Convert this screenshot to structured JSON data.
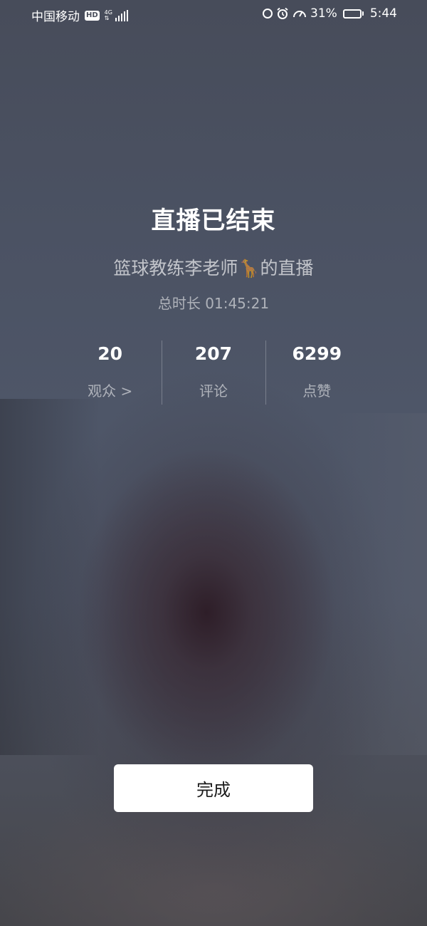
{
  "status_bar": {
    "carrier": "中国移动",
    "hd_badge": "HD",
    "network_type": "4G",
    "signal_icon": "signal-icon",
    "battery_percent": "31%",
    "battery_level": 0.31,
    "time": "5:44",
    "icons": [
      "data-saver-icon",
      "alarm-icon",
      "speed-icon",
      "battery-icon"
    ]
  },
  "live_ended": {
    "title": "直播已结束",
    "subtitle": "篮球教练李老师🦒的直播",
    "duration_label": "总时长 01:45:21"
  },
  "stats": [
    {
      "value": "20",
      "label": "观众 >"
    },
    {
      "value": "207",
      "label": "评论"
    },
    {
      "value": "6299",
      "label": "点赞"
    }
  ],
  "actions": {
    "done_label": "完成"
  },
  "colors": {
    "background": "#4b5263",
    "button_bg": "#ffffff",
    "button_text": "#1a1a1a"
  }
}
